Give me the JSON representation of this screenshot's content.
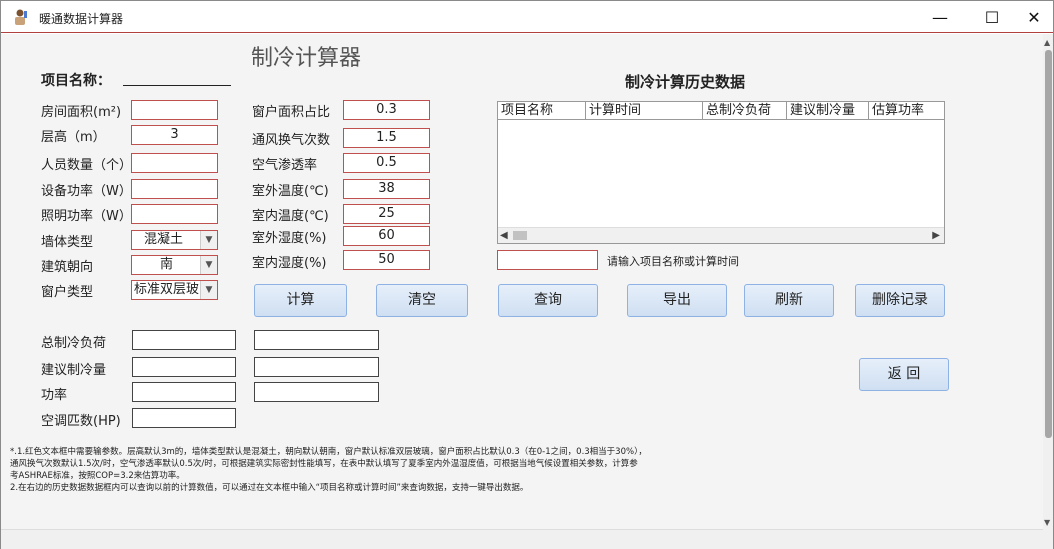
{
  "window": {
    "title": "暖通数据计算器",
    "controls": {
      "minimize": "—",
      "maximize": "☐",
      "close": "✕"
    }
  },
  "main": {
    "heading": "制冷计算器",
    "project_name_label": "项目名称：",
    "left_fields": [
      {
        "label": "房间面积(m²)",
        "value": ""
      },
      {
        "label": "层高（m）",
        "value": "3"
      },
      {
        "label": "人员数量（个）",
        "value": ""
      },
      {
        "label": "设备功率（W）",
        "value": ""
      },
      {
        "label": "照明功率（W）",
        "value": ""
      }
    ],
    "selects": [
      {
        "label": "墙体类型",
        "value": "混凝土"
      },
      {
        "label": "建筑朝向",
        "value": "南"
      },
      {
        "label": "窗户类型",
        "value": "标准双层玻"
      }
    ],
    "mid_fields": [
      {
        "label": "窗户面积占比",
        "value": "0.3"
      },
      {
        "label": "通风换气次数",
        "value": "1.5"
      },
      {
        "label": "空气渗透率",
        "value": "0.5"
      },
      {
        "label": "室外温度(℃)",
        "value": "38"
      },
      {
        "label": "室内温度(℃)",
        "value": "25"
      },
      {
        "label": "室外湿度(%)",
        "value": "60"
      },
      {
        "label": "室内湿度(%)",
        "value": "50"
      }
    ],
    "buttons": {
      "calculate": "计算",
      "clear": "清空",
      "query": "查询",
      "export": "导出",
      "refresh": "刷新",
      "delete": "删除记录",
      "back": "返 回"
    },
    "results": [
      {
        "label": "总制冷负荷",
        "value1": "",
        "value2": ""
      },
      {
        "label": "建议制冷量",
        "value1": "",
        "value2": ""
      },
      {
        "label": "功率",
        "value1": "",
        "value2": ""
      },
      {
        "label": "空调匹数(HP)",
        "value1": ""
      }
    ]
  },
  "history": {
    "heading": "制冷计算历史数据",
    "columns": [
      "项目名称",
      "计算时间",
      "总制冷负荷",
      "建议制冷量",
      "估算功率"
    ],
    "search_value": "",
    "search_hint": "请输入项目名称或计算时间"
  },
  "notes": {
    "line1": "*.1.红色文本框中需要输参数。层高默认3m的，墙体类型默认是混凝土，朝向默认朝南，窗户默认标准双层玻璃，窗户面积占比默认0.3（在0-1之间，0.3相当于30%），",
    "line2": "通风换气次数默认1.5次/时，空气渗透率默认0.5次/时，可根据建筑实际密封性能填写，在表中默认填写了夏季室内外温湿度值，可根据当地气候设置相关参数，计算参",
    "line3": "考ASHRAE标准，按照COP=3.2来估算功率。",
    "line4": "2.在右边的历史数据数据框内可以查询以前的计算数值，可以通过在文本框中输入“项目名称或计算时间”来查询数据，支持一键导出数据。"
  },
  "colors": {
    "required_border": "#c0504d",
    "button_fill": "#dbe7f6",
    "button_border": "#8db2e3"
  }
}
